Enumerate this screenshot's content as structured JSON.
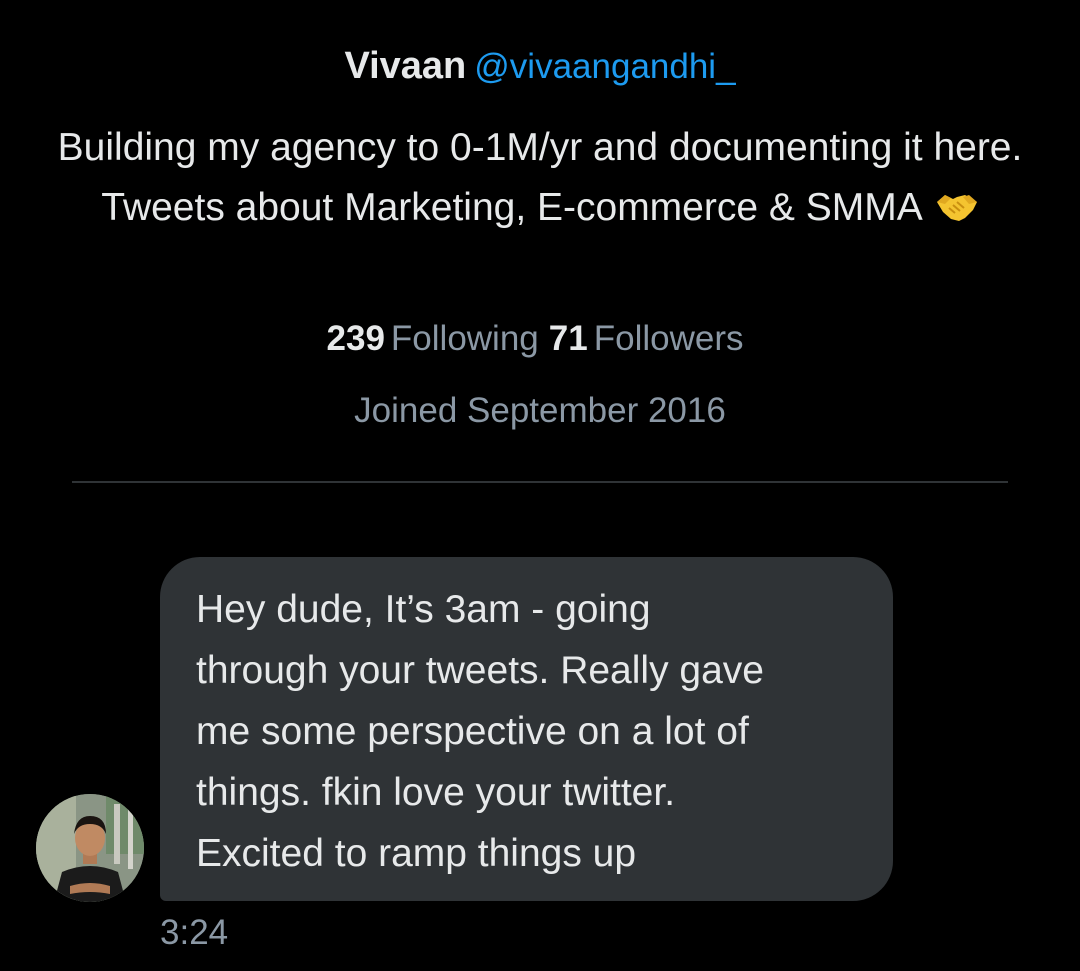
{
  "profile": {
    "display_name": "Vivaan",
    "handle": "@vivaangandhi_",
    "bio": "Building my agency to 0-1M/yr and documenting it here. Tweets about Marketing, E-commerce & SMMA",
    "bio_emoji_icon": "handshake-emoji",
    "following_count": "239",
    "following_label": "Following",
    "followers_count": "71",
    "followers_label": "Followers",
    "joined": "Joined September 2016"
  },
  "message": {
    "text": "Hey dude, It’s 3am - going\nthrough your tweets. Really gave\nme some perspective on a lot of\nthings. fkin love your twitter.\nExcited to ramp things up",
    "timestamp": "3:24",
    "avatar_icon": "user-avatar"
  },
  "colors": {
    "background": "#000000",
    "text_primary": "#e7e9ea",
    "text_secondary": "#8b98a5",
    "link": "#1d9bf0",
    "bubble": "#2f3336",
    "divider": "#2f3336"
  }
}
